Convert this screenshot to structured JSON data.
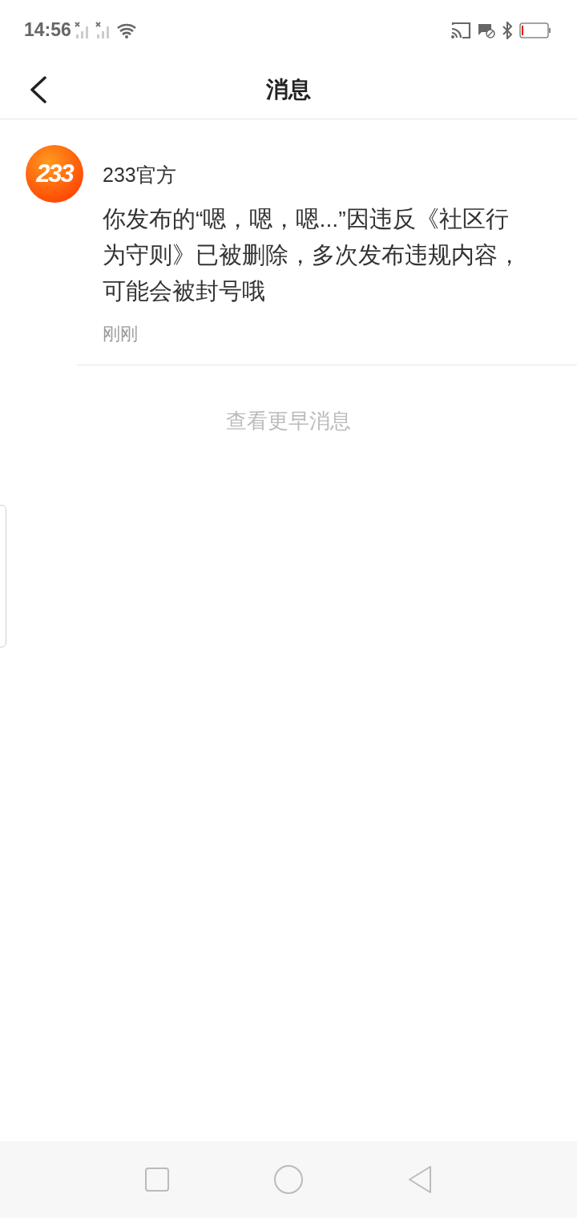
{
  "status_bar": {
    "time": "14:56"
  },
  "header": {
    "title": "消息"
  },
  "messages": [
    {
      "avatar_text": "233",
      "sender": "233官方",
      "text": "你发布的“嗯，嗯，嗯...”因违反《社区行为守则》已被删除，多次发布违规内容，可能会被封号哦",
      "time": "刚刚"
    }
  ],
  "load_more": "查看更早消息"
}
